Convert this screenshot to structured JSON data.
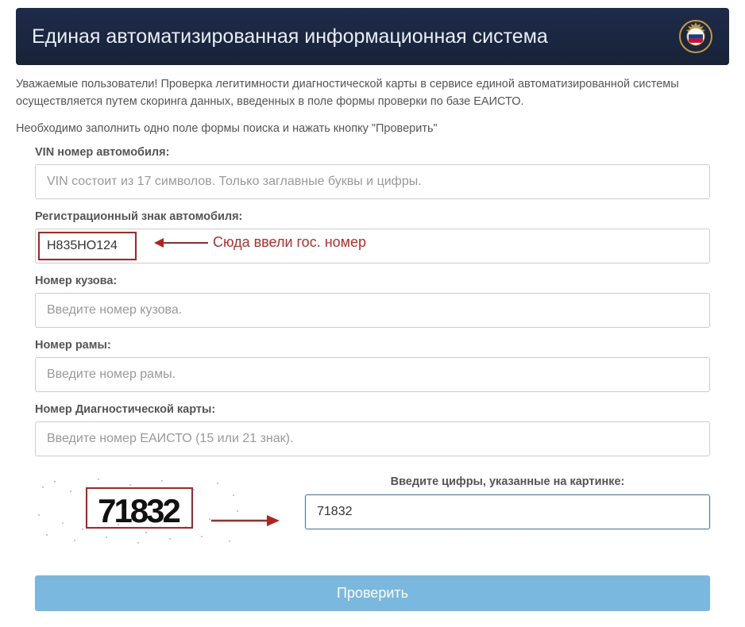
{
  "header": {
    "title": "Единая автоматизированная информационная система"
  },
  "intro": "Уважаемые пользователи! Проверка легитимности диагностической карты в сервисе единой автоматизированной системы осуществляется путем скоринга данных, введенных в поле формы проверки по базе ЕАИСТО.",
  "instruction": "Необходимо заполнить одно поле формы поиска и нажать кнопку \"Проверить\"",
  "fields": {
    "vin": {
      "label": "VIN номер автомобиля:",
      "placeholder": "VIN состоит из 17 символов. Только заглавные буквы и цифры.",
      "value": ""
    },
    "regplate": {
      "label": "Регистрационный знак автомобиля:",
      "placeholder": "",
      "value": "Н835НО124"
    },
    "body": {
      "label": "Номер кузова:",
      "placeholder": "Введите номер кузова.",
      "value": ""
    },
    "frame": {
      "label": "Номер рамы:",
      "placeholder": "Введите номер рамы.",
      "value": ""
    },
    "diagcard": {
      "label": "Номер Диагностической карты:",
      "placeholder": "Введите номер ЕАИСТО (15 или 21 знак).",
      "value": ""
    }
  },
  "annotation": {
    "regplate": "Сюда ввели гос. номер"
  },
  "captcha": {
    "image_value": "71832",
    "input_label": "Введите цифры, указанные на картинке:",
    "input_value": "71832"
  },
  "submit_label": "Проверить"
}
